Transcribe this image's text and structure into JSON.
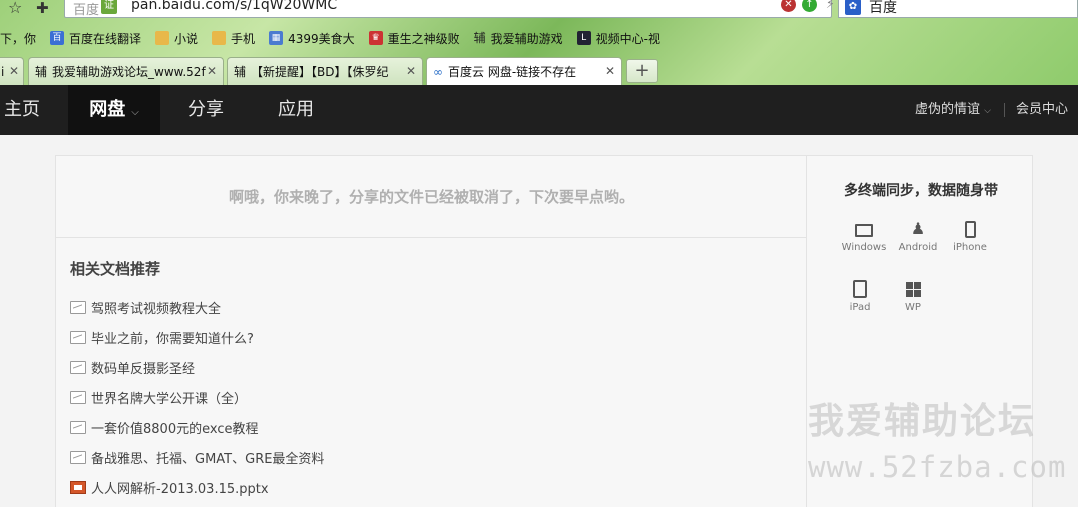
{
  "browser": {
    "url_site": "百度",
    "url_verify": "证",
    "url": "pan.baidu.com/s/1qW20WMC",
    "search_engine": "百度",
    "bookmarks": [
      {
        "label": "下，你",
        "icon": "none"
      },
      {
        "label": "百度在线翻译",
        "icon": "baidu-translate-icon"
      },
      {
        "label": "小说",
        "icon": "folder-icon"
      },
      {
        "label": "手机",
        "icon": "folder-icon"
      },
      {
        "label": "4399美食大",
        "icon": "grid-icon"
      },
      {
        "label": "重生之神级败",
        "icon": "game-icon"
      },
      {
        "label": "我爱辅助游戏",
        "icon": "fu-icon"
      },
      {
        "label": "视频中心-视",
        "icon": "video-icon"
      }
    ],
    "tabs": [
      {
        "label": "i",
        "icon": ""
      },
      {
        "label": "我爱辅助游戏论坛_www.52f",
        "icon": "辅"
      },
      {
        "label": "【新提醒】【BD】【侏罗纪",
        "icon": "辅"
      },
      {
        "label": "百度云 网盘-链接不存在",
        "icon": "∞"
      }
    ],
    "new_tab": "+"
  },
  "nav": {
    "home": "主页",
    "disk": "网盘",
    "share": "分享",
    "apps": "应用",
    "user": "虚伪的情谊",
    "vip": "会员中心"
  },
  "main": {
    "notice": "啊哦，你来晚了，分享的文件已经被取消了，下次要早点哟。",
    "rec_title": "相关文档推荐",
    "rec_items": [
      {
        "label": "驾照考试视频教程大全",
        "type": "doc"
      },
      {
        "label": "毕业之前，你需要知道什么?",
        "type": "doc"
      },
      {
        "label": "数码单反摄影圣经",
        "type": "doc"
      },
      {
        "label": "世界名牌大学公开课（全）",
        "type": "doc"
      },
      {
        "label": "一套价值8800元的exce教程",
        "type": "doc"
      },
      {
        "label": "备战雅思、托福、GMAT、GRE最全资料",
        "type": "doc"
      },
      {
        "label": "人人网解析-2013.03.15.pptx",
        "type": "ppt"
      }
    ]
  },
  "sync": {
    "title": "多终端同步，数据随身带",
    "devices": [
      {
        "label": "Windows",
        "icon": "pc-icon"
      },
      {
        "label": "Android",
        "icon": "android-icon"
      },
      {
        "label": "iPhone",
        "icon": "iphone-icon"
      },
      {
        "label": "iPad",
        "icon": "ipad-icon"
      },
      {
        "label": "WP",
        "icon": "windows-phone-icon"
      }
    ]
  },
  "watermark": {
    "line1": "我爱辅助论坛",
    "line2": "www.52fzba.com"
  }
}
